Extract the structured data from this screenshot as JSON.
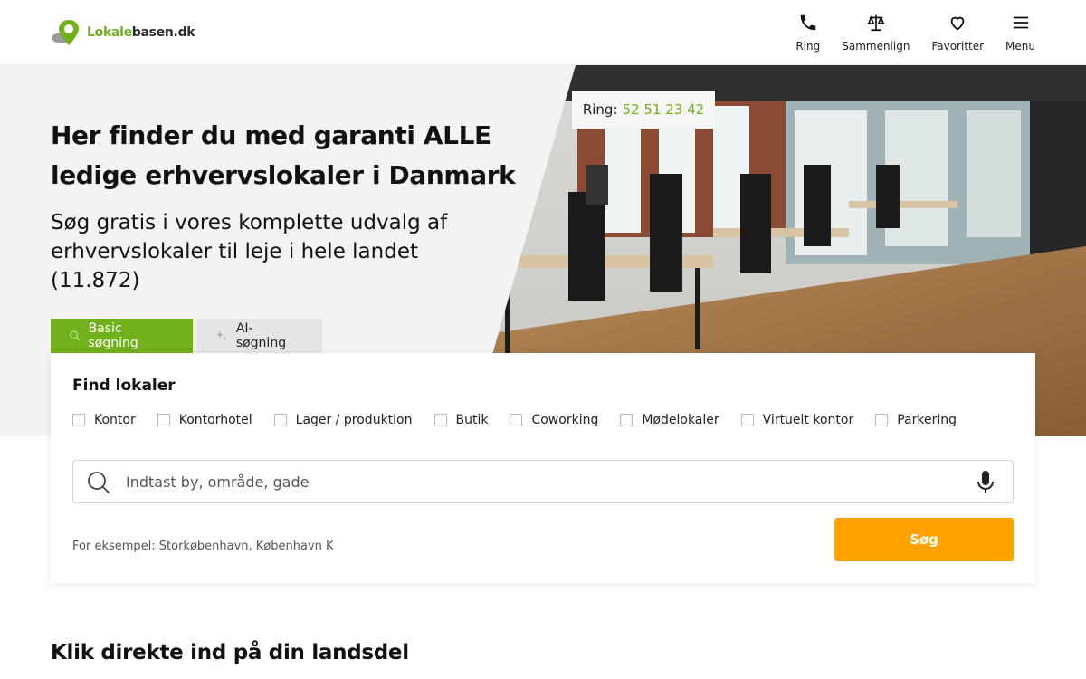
{
  "header": {
    "logo_green": "Lokale",
    "logo_dark": "basen.dk",
    "nav": [
      {
        "label": "Ring",
        "icon": "phone-icon"
      },
      {
        "label": "Sammenlign",
        "icon": "scale-icon"
      },
      {
        "label": "Favoritter",
        "icon": "heart-icon"
      },
      {
        "label": "Menu",
        "icon": "menu-icon"
      }
    ]
  },
  "hero": {
    "ring_label": "Ring:",
    "ring_number": "52 51 23 42",
    "title": "Her finder du med garanti ALLE ledige erhvervslokaler i Danmark",
    "subtitle": "Søg gratis i vores komplette udvalg af erhvervslokaler til leje i hele landet (11.872)"
  },
  "tabs": [
    {
      "label": "Basic søgning",
      "active": true
    },
    {
      "label": "AI-søgning",
      "active": false
    }
  ],
  "search_card": {
    "title": "Find lokaler",
    "types": [
      "Kontor",
      "Kontorhotel",
      "Lager / produktion",
      "Butik",
      "Coworking",
      "Mødelokaler",
      "Virtuelt kontor",
      "Parkering"
    ],
    "placeholder": "Indtast by, område, gade",
    "example": "For eksempel: Storkøbenhavn, København K",
    "button": "Søg"
  },
  "section": {
    "title": "Klik direkte ind på din landsdel"
  },
  "colors": {
    "brand_green": "#72b01d",
    "search_orange": "#ffa200"
  }
}
